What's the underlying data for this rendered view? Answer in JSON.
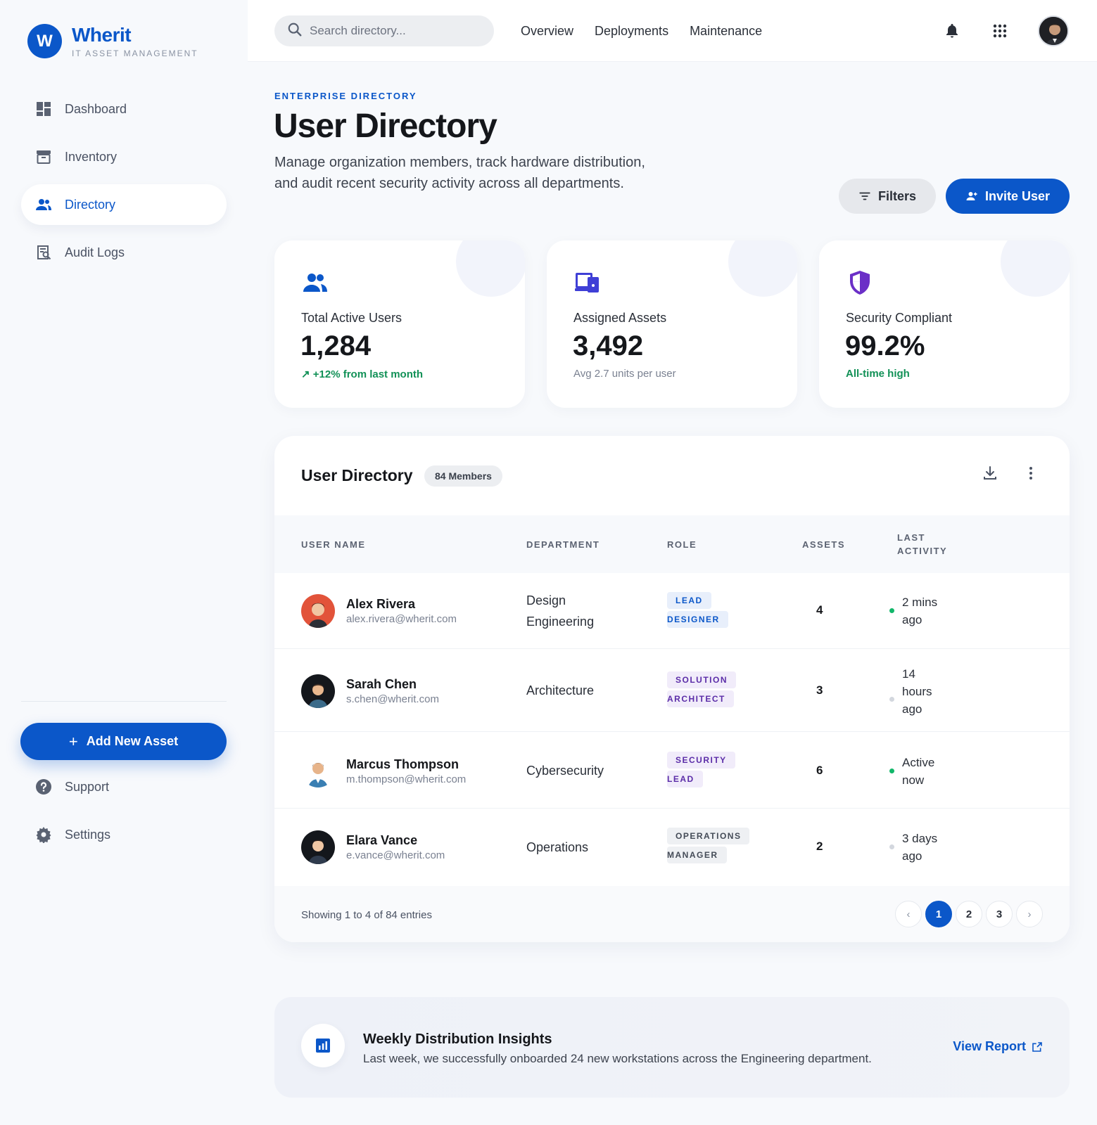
{
  "brand": {
    "logo_letter": "W",
    "name": "Wherit",
    "subtitle": "IT ASSET MANAGEMENT",
    "accent": "#0b57c9"
  },
  "sidebar": {
    "items": [
      {
        "label": "Dashboard",
        "icon": "dashboard-icon",
        "active": false
      },
      {
        "label": "Inventory",
        "icon": "archive-icon",
        "active": false
      },
      {
        "label": "Directory",
        "icon": "users-icon",
        "active": true
      },
      {
        "label": "Audit Logs",
        "icon": "audit-log-icon",
        "active": false
      }
    ],
    "add_asset_label": "Add New Asset",
    "bottom_items": [
      {
        "label": "Support",
        "icon": "help-icon"
      },
      {
        "label": "Settings",
        "icon": "gear-icon"
      }
    ]
  },
  "topbar": {
    "search_placeholder": "Search directory...",
    "links": [
      "Overview",
      "Deployments",
      "Maintenance"
    ],
    "icons": [
      "bell-icon",
      "apps-grid-icon"
    ]
  },
  "header": {
    "eyebrow": "ENTERPRISE DIRECTORY",
    "title": "User Directory",
    "description": "Manage organization members, track hardware distribution, and audit recent security activity across all departments.",
    "filters_label": "Filters",
    "invite_label": "Invite User"
  },
  "stats": [
    {
      "icon": "users-icon",
      "label": "Total Active Users",
      "value": "1,284",
      "sub": "+12% from last month",
      "sub_style": "green",
      "trend_icon": "trending-up-icon",
      "icon_color": "#0b57c9"
    },
    {
      "icon": "devices-icon",
      "label": "Assigned Assets",
      "value": "3,492",
      "sub": "Avg 2.7 units per user",
      "sub_style": "grey",
      "icon_color": "#3f3fd6"
    },
    {
      "icon": "shield-icon",
      "label": "Security Compliant",
      "value": "99.2%",
      "sub": "All-time high",
      "sub_style": "green",
      "icon_color": "#6b2fc7"
    }
  ],
  "table": {
    "title": "User Directory",
    "badge": "84 Members",
    "columns": [
      "USER NAME",
      "DEPARTMENT",
      "ROLE",
      "ASSETS",
      "LAST ACTIVITY"
    ],
    "rows": [
      {
        "name": "Alex Rivera",
        "email": "alex.rivera@wherit.com",
        "department": "Design Engineering",
        "role": [
          "LEAD",
          "DESIGNER"
        ],
        "role_style": "blue",
        "assets": "4",
        "activity": "2 mins ago",
        "online": true,
        "avatar_bg": "#e2533a"
      },
      {
        "name": "Sarah Chen",
        "email": "s.chen@wherit.com",
        "department": "Architecture",
        "role": [
          "SOLUTION",
          "ARCHITECT"
        ],
        "role_style": "purple",
        "assets": "3",
        "activity": "14 hours ago",
        "online": false,
        "avatar_bg": "#14171c"
      },
      {
        "name": "Marcus Thompson",
        "email": "m.thompson@wherit.com",
        "department": "Cybersecurity",
        "role": [
          "SECURITY",
          "LEAD"
        ],
        "role_style": "purple",
        "assets": "6",
        "activity": "Active now",
        "online": true,
        "avatar_bg": "#ffffff"
      },
      {
        "name": "Elara Vance",
        "email": "e.vance@wherit.com",
        "department": "Operations",
        "role": [
          "OPERATIONS",
          "MANAGER"
        ],
        "role_style": "grey",
        "assets": "2",
        "activity": "3 days ago",
        "online": false,
        "avatar_bg": "#14171c"
      }
    ],
    "footer_info": "Showing 1 to 4 of 84 entries",
    "pages": [
      "1",
      "2",
      "3"
    ],
    "current_page": "1",
    "prev": "‹",
    "next": "›"
  },
  "insights": {
    "title": "Weekly Distribution Insights",
    "text": "Last week, we successfully onboarded 24 new workstations across the Engineering department.",
    "link": "View Report"
  }
}
